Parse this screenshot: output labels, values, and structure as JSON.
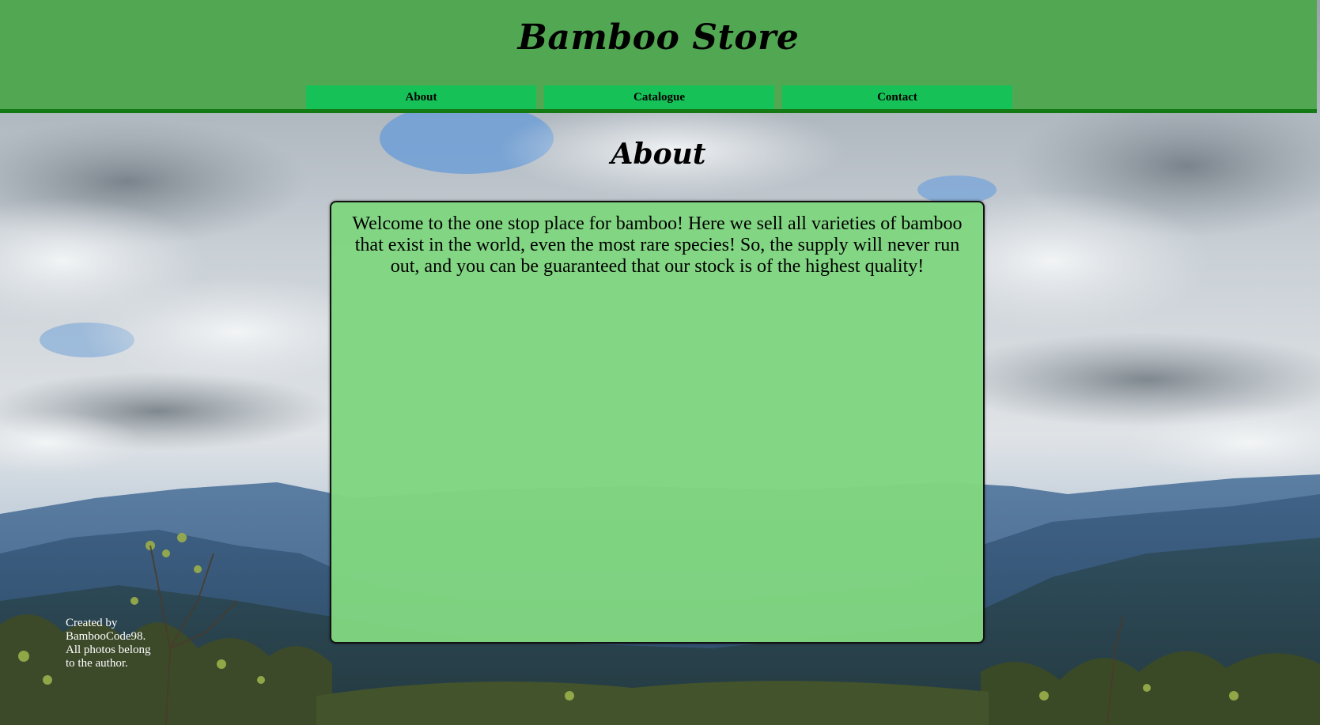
{
  "header": {
    "title": "Bamboo Store",
    "nav": [
      {
        "label": "About"
      },
      {
        "label": "Catalogue"
      },
      {
        "label": "Contact"
      }
    ]
  },
  "main": {
    "heading": "About",
    "body": "Welcome to the one stop place for bamboo! Here we sell all varieties of bamboo that exist in the world, even the most rare species! So, the supply will never run out, and you can be guaranteed that our stock is of the highest quality!"
  },
  "footer": {
    "credit": "Created by BambooCode98. All photos belong to the author."
  },
  "colors": {
    "header_bg": "#52a852",
    "header_border": "#147a14",
    "nav_bg": "#16c157",
    "content_bg": "#80d680"
  },
  "background": "mountain-landscape-photo"
}
